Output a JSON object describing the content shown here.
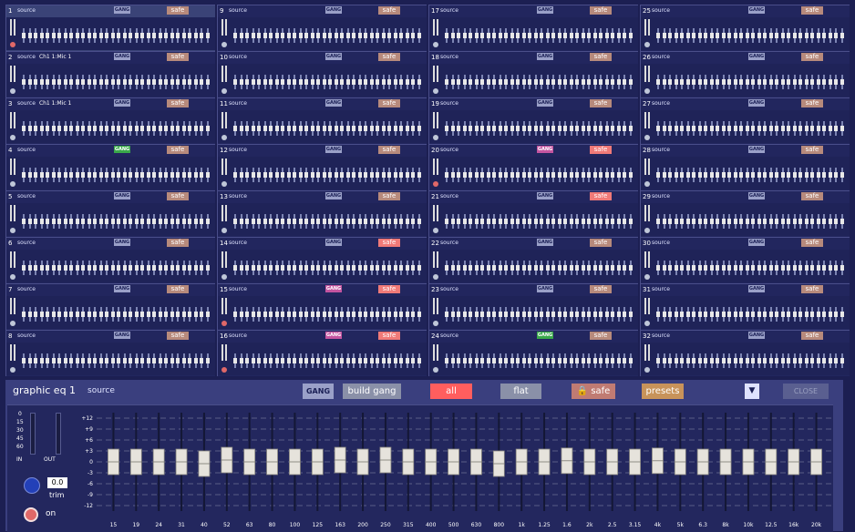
{
  "cells": [
    {
      "num": "1",
      "src": "source",
      "ch": "",
      "gang": "GANG",
      "gang_color": "gray",
      "safe": "safe",
      "safe_hot": false,
      "lamp": "red",
      "selected": true
    },
    {
      "num": "2",
      "src": "source",
      "ch": "Ch1 1:Mic 1",
      "gang": "GANG",
      "gang_color": "gray",
      "safe": "safe",
      "safe_hot": false,
      "lamp": "gray",
      "selected": false
    },
    {
      "num": "3",
      "src": "source",
      "ch": "Ch1 1:Mic 1",
      "gang": "GANG",
      "gang_color": "gray",
      "safe": "safe",
      "safe_hot": false,
      "lamp": "gray",
      "selected": false
    },
    {
      "num": "4",
      "src": "source",
      "ch": "",
      "gang": "GANG",
      "gang_color": "green",
      "safe": "safe",
      "safe_hot": false,
      "lamp": "gray",
      "selected": false
    },
    {
      "num": "5",
      "src": "source",
      "ch": "",
      "gang": "GANG",
      "gang_color": "gray",
      "safe": "safe",
      "safe_hot": false,
      "lamp": "gray",
      "selected": false
    },
    {
      "num": "6",
      "src": "source",
      "ch": "",
      "gang": "GANG",
      "gang_color": "gray",
      "safe": "safe",
      "safe_hot": false,
      "lamp": "gray",
      "selected": false
    },
    {
      "num": "7",
      "src": "source",
      "ch": "",
      "gang": "GANG",
      "gang_color": "gray",
      "safe": "safe",
      "safe_hot": false,
      "lamp": "gray",
      "selected": false
    },
    {
      "num": "8",
      "src": "source",
      "ch": "",
      "gang": "GANG",
      "gang_color": "gray",
      "safe": "safe",
      "safe_hot": false,
      "lamp": "gray",
      "selected": false
    },
    {
      "num": "9",
      "src": "source",
      "ch": "",
      "gang": "GANG",
      "gang_color": "gray",
      "safe": "safe",
      "safe_hot": false,
      "lamp": "gray",
      "selected": false
    },
    {
      "num": "10",
      "src": "source",
      "ch": "",
      "gang": "GANG",
      "gang_color": "gray",
      "safe": "safe",
      "safe_hot": false,
      "lamp": "gray",
      "selected": false
    },
    {
      "num": "11",
      "src": "source",
      "ch": "",
      "gang": "GANG",
      "gang_color": "gray",
      "safe": "safe",
      "safe_hot": false,
      "lamp": "gray",
      "selected": false
    },
    {
      "num": "12",
      "src": "source",
      "ch": "",
      "gang": "GANG",
      "gang_color": "gray",
      "safe": "safe",
      "safe_hot": false,
      "lamp": "gray",
      "selected": false
    },
    {
      "num": "13",
      "src": "source",
      "ch": "",
      "gang": "GANG",
      "gang_color": "gray",
      "safe": "safe",
      "safe_hot": false,
      "lamp": "gray",
      "selected": false
    },
    {
      "num": "14",
      "src": "source",
      "ch": "",
      "gang": "GANG",
      "gang_color": "gray",
      "safe": "safe",
      "safe_hot": true,
      "lamp": "gray",
      "selected": false
    },
    {
      "num": "15",
      "src": "source",
      "ch": "",
      "gang": "GANG",
      "gang_color": "pink",
      "safe": "safe",
      "safe_hot": true,
      "lamp": "red",
      "selected": false
    },
    {
      "num": "16",
      "src": "source",
      "ch": "",
      "gang": "GANG",
      "gang_color": "pink",
      "safe": "safe",
      "safe_hot": true,
      "lamp": "red",
      "selected": false
    },
    {
      "num": "17",
      "src": "source",
      "ch": "",
      "gang": "GANG",
      "gang_color": "gray",
      "safe": "safe",
      "safe_hot": false,
      "lamp": "gray",
      "selected": false
    },
    {
      "num": "18",
      "src": "source",
      "ch": "",
      "gang": "GANG",
      "gang_color": "gray",
      "safe": "safe",
      "safe_hot": false,
      "lamp": "gray",
      "selected": false
    },
    {
      "num": "19",
      "src": "source",
      "ch": "",
      "gang": "GANG",
      "gang_color": "gray",
      "safe": "safe",
      "safe_hot": false,
      "lamp": "gray",
      "selected": false
    },
    {
      "num": "20",
      "src": "source",
      "ch": "",
      "gang": "GANG",
      "gang_color": "pink",
      "safe": "safe",
      "safe_hot": true,
      "lamp": "red",
      "selected": false
    },
    {
      "num": "21",
      "src": "source",
      "ch": "",
      "gang": "GANG",
      "gang_color": "gray",
      "safe": "safe",
      "safe_hot": true,
      "lamp": "gray",
      "selected": false
    },
    {
      "num": "22",
      "src": "source",
      "ch": "",
      "gang": "GANG",
      "gang_color": "gray",
      "safe": "safe",
      "safe_hot": false,
      "lamp": "gray",
      "selected": false
    },
    {
      "num": "23",
      "src": "source",
      "ch": "",
      "gang": "GANG",
      "gang_color": "gray",
      "safe": "safe",
      "safe_hot": false,
      "lamp": "gray",
      "selected": false
    },
    {
      "num": "24",
      "src": "source",
      "ch": "",
      "gang": "GANG",
      "gang_color": "green",
      "safe": "safe",
      "safe_hot": false,
      "lamp": "gray",
      "selected": false
    },
    {
      "num": "25",
      "src": "source",
      "ch": "",
      "gang": "GANG",
      "gang_color": "gray",
      "safe": "safe",
      "safe_hot": false,
      "lamp": "gray",
      "selected": false
    },
    {
      "num": "26",
      "src": "source",
      "ch": "",
      "gang": "GANG",
      "gang_color": "gray",
      "safe": "safe",
      "safe_hot": false,
      "lamp": "gray",
      "selected": false
    },
    {
      "num": "27",
      "src": "source",
      "ch": "",
      "gang": "GANG",
      "gang_color": "gray",
      "safe": "safe",
      "safe_hot": false,
      "lamp": "gray",
      "selected": false
    },
    {
      "num": "28",
      "src": "source",
      "ch": "",
      "gang": "GANG",
      "gang_color": "gray",
      "safe": "safe",
      "safe_hot": false,
      "lamp": "gray",
      "selected": false
    },
    {
      "num": "29",
      "src": "source",
      "ch": "",
      "gang": "GANG",
      "gang_color": "gray",
      "safe": "safe",
      "safe_hot": false,
      "lamp": "gray",
      "selected": false
    },
    {
      "num": "30",
      "src": "source",
      "ch": "",
      "gang": "GANG",
      "gang_color": "gray",
      "safe": "safe",
      "safe_hot": false,
      "lamp": "gray",
      "selected": false
    },
    {
      "num": "31",
      "src": "source",
      "ch": "",
      "gang": "GANG",
      "gang_color": "gray",
      "safe": "safe",
      "safe_hot": false,
      "lamp": "gray",
      "selected": false
    },
    {
      "num": "32",
      "src": "source",
      "ch": "",
      "gang": "GANG",
      "gang_color": "gray",
      "safe": "safe",
      "safe_hot": false,
      "lamp": "gray",
      "selected": false
    }
  ],
  "panel": {
    "title": "graphic eq 1",
    "source": "source",
    "gang_label": "GANG",
    "build_gang_label": "build gang",
    "all_label": "all",
    "flat_label": "flat",
    "safe_label": "safe",
    "presets_label": "presets",
    "dropdown_glyph": "▼",
    "close_label": "CLOSE",
    "trim_value": "0.0",
    "trim_label": "trim",
    "on_label": "on",
    "in_label": "IN",
    "out_label": "OUT",
    "meter_ticks": [
      "0",
      "15",
      "30",
      "45",
      "60"
    ]
  },
  "eq": {
    "db_scale": [
      "+12",
      "+9",
      "+6",
      "+3",
      "0",
      "-3",
      "-6",
      "-9",
      "-12"
    ],
    "bands": [
      "15",
      "19",
      "24",
      "31",
      "40",
      "52",
      "63",
      "80",
      "100",
      "125",
      "163",
      "200",
      "250",
      "315",
      "400",
      "500",
      "630",
      "800",
      "1k",
      "1.25",
      "1.6",
      "2k",
      "2.5",
      "3.15",
      "4k",
      "5k",
      "6.3",
      "8k",
      "10k",
      "12.5",
      "16k",
      "20k"
    ],
    "gains_db": [
      0,
      0,
      0,
      0,
      -0.5,
      0.5,
      0,
      0,
      0,
      0,
      0.5,
      0,
      0.5,
      0,
      0,
      0,
      0,
      -0.5,
      0,
      0,
      0.3,
      0,
      0,
      0,
      0.3,
      0,
      0,
      0,
      0,
      0,
      0,
      0
    ]
  },
  "colors": {
    "accent_red": "#ff5e5e",
    "safe_hot": "#f07a78",
    "gang_green": "#3aa84a",
    "gang_pink": "#c455a0"
  }
}
